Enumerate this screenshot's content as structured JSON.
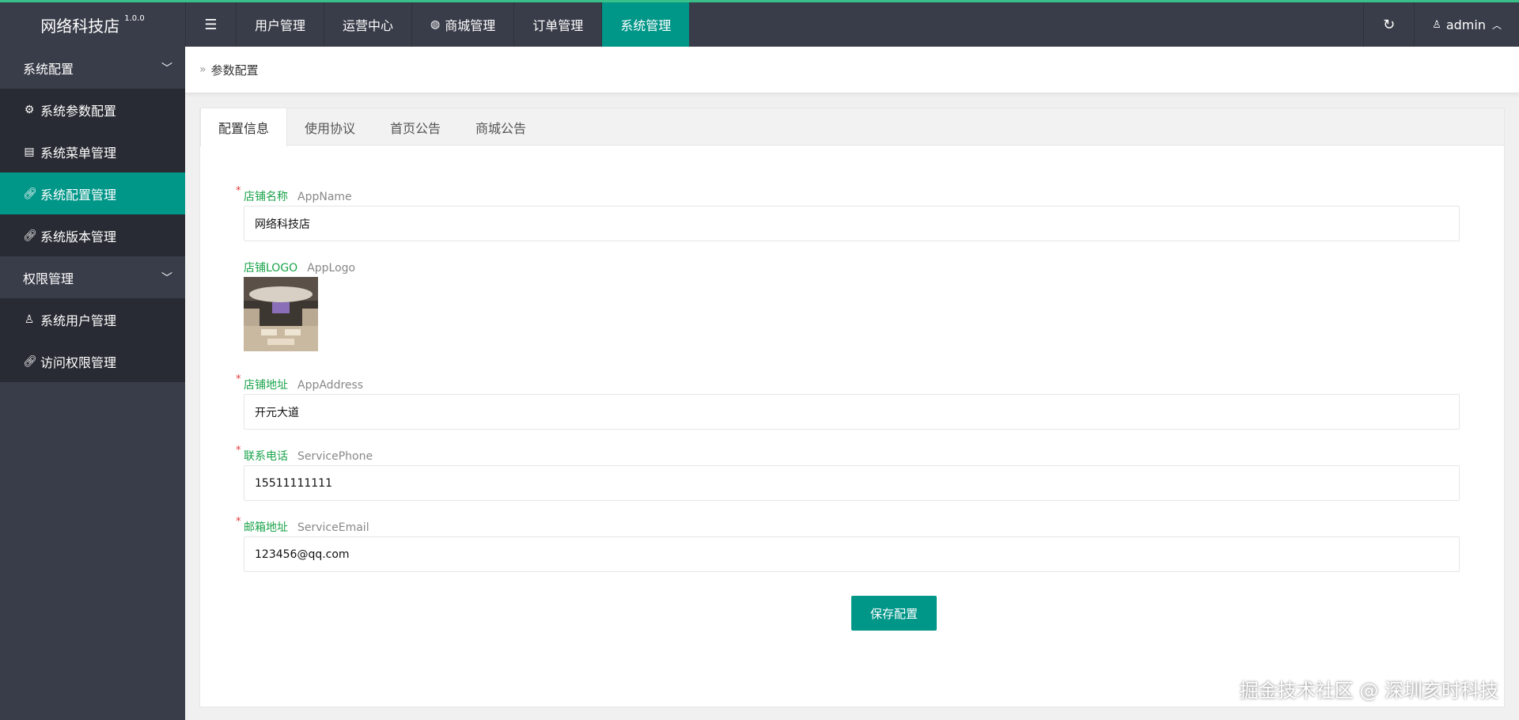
{
  "brand": {
    "name": "网络科技店",
    "version": "1.0.0"
  },
  "nav": {
    "items": [
      {
        "label": "用户管理"
      },
      {
        "label": "运营中心"
      },
      {
        "label": "商城管理"
      },
      {
        "label": "订单管理"
      },
      {
        "label": "系统管理"
      }
    ],
    "active": "系统管理"
  },
  "top_right": {
    "user": "admin"
  },
  "sidebar": {
    "groups": [
      {
        "label": "系统配置",
        "items": [
          {
            "label": "系统参数配置",
            "icon": "gear-icon"
          },
          {
            "label": "系统菜单管理",
            "icon": "window-icon"
          },
          {
            "label": "系统配置管理",
            "icon": "link-icon",
            "active": true
          },
          {
            "label": "系统版本管理",
            "icon": "link-icon"
          }
        ]
      },
      {
        "label": "权限管理",
        "items": [
          {
            "label": "系统用户管理",
            "icon": "user-icon"
          },
          {
            "label": "访问权限管理",
            "icon": "link-icon"
          }
        ]
      }
    ]
  },
  "breadcrumb": {
    "current": "参数配置"
  },
  "tabs": [
    {
      "label": "配置信息",
      "active": true
    },
    {
      "label": "使用协议"
    },
    {
      "label": "首页公告"
    },
    {
      "label": "商城公告"
    }
  ],
  "form": {
    "app_name": {
      "label": "店铺名称",
      "en": "AppName",
      "value": "网络科技店",
      "required": "*"
    },
    "app_logo": {
      "label": "店铺LOGO",
      "en": "AppLogo"
    },
    "app_address": {
      "label": "店铺地址",
      "en": "AppAddress",
      "value": "开元大道",
      "required": "*"
    },
    "service_phone": {
      "label": "联系电话",
      "en": "ServicePhone",
      "value": "15511111111",
      "required": "*"
    },
    "service_email": {
      "label": "邮箱地址",
      "en": "ServiceEmail",
      "value": "123456@qq.com",
      "required": "*"
    },
    "save_label": "保存配置"
  },
  "watermark": "掘金技术社区 @ 深圳亥时科技",
  "colors": {
    "accent": "#009688",
    "topbar": "#393d49",
    "sidebar_item": "#282b33",
    "label_green": "#1aa34a",
    "required_red": "#e13b3b"
  }
}
